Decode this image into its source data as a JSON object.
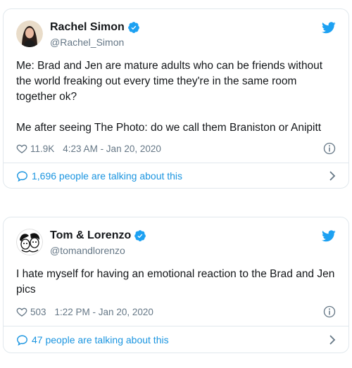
{
  "colors": {
    "accent": "#1da1f2",
    "link": "#1b95e0",
    "muted": "#657786",
    "text": "#14171a",
    "border": "#e1e8ed"
  },
  "tweets": [
    {
      "display_name": "Rachel Simon",
      "handle": "@Rachel_Simon",
      "verified_icon": "verified-badge-icon",
      "paragraphs": [
        "Me: Brad and Jen are mature adults who can be friends without the world freaking out every time they're in the same room together ok?",
        "Me after seeing The Photo: do we call them Braniston or Anipitt"
      ],
      "likes": "11.9K",
      "timestamp": "4:23 AM - Jan 20, 2020",
      "talking": "1,696 people are talking about this"
    },
    {
      "display_name": "Tom & Lorenzo",
      "handle": "@tomandlorenzo",
      "verified_icon": "verified-badge-icon",
      "paragraphs": [
        "I hate myself for having an emotional reaction to the Brad and Jen pics"
      ],
      "likes": "503",
      "timestamp": "1:22 PM - Jan 20, 2020",
      "talking": "47 people are talking about this"
    }
  ]
}
